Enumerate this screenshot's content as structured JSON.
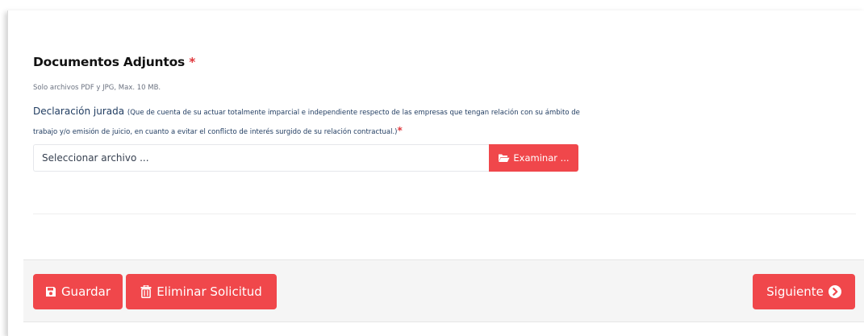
{
  "section": {
    "title": "Documentos Adjuntos",
    "required_mark": "*",
    "hint": "Solo archivos PDF y JPG, Max. 10 MB."
  },
  "field": {
    "label": "Declaración jurada",
    "description": "(Que de cuenta de su actuar totalmente imparcial e independiente respecto de las empresas que tengan relación con su ámbito de trabajo y/o emisión de juicio, en cuanto a evitar el conflicto de interés surgido de su relación contractual.)",
    "required_mark": "*",
    "placeholder": "Seleccionar archivo ...",
    "browse_label": "Examinar ..."
  },
  "footer": {
    "save_label": "Guardar",
    "delete_label": "Eliminar Solicitud",
    "next_label": "Siguiente"
  },
  "colors": {
    "accent": "#f0474b",
    "label_text": "#1e3a5f",
    "required": "#e0393e"
  },
  "icons": {
    "browse": "folder-open-icon",
    "save": "floppy-disk-icon",
    "delete": "trash-icon",
    "next": "chevron-circle-right-icon"
  }
}
